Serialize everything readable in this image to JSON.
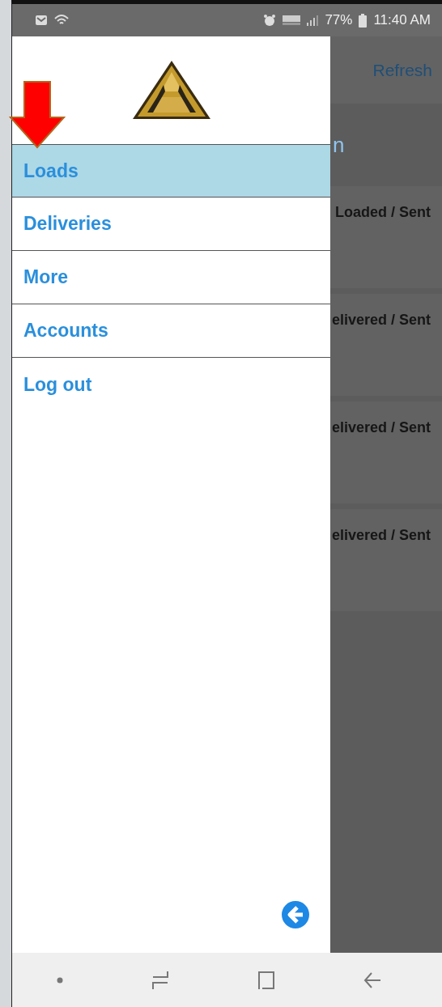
{
  "status_bar": {
    "battery": "77%",
    "time": "11:40 AM"
  },
  "drawer": {
    "items": [
      {
        "label": "Loads",
        "selected": true
      },
      {
        "label": "Deliveries",
        "selected": false
      },
      {
        "label": "More",
        "selected": false
      },
      {
        "label": "Accounts",
        "selected": false
      },
      {
        "label": "Log out",
        "selected": false
      }
    ]
  },
  "background": {
    "header_action": "Refresh",
    "title": "n",
    "cards": [
      {
        "status": "Loaded / Sent"
      },
      {
        "status": "elivered / Sent"
      },
      {
        "status": "elivered / Sent"
      },
      {
        "status": "elivered / Sent"
      }
    ]
  }
}
